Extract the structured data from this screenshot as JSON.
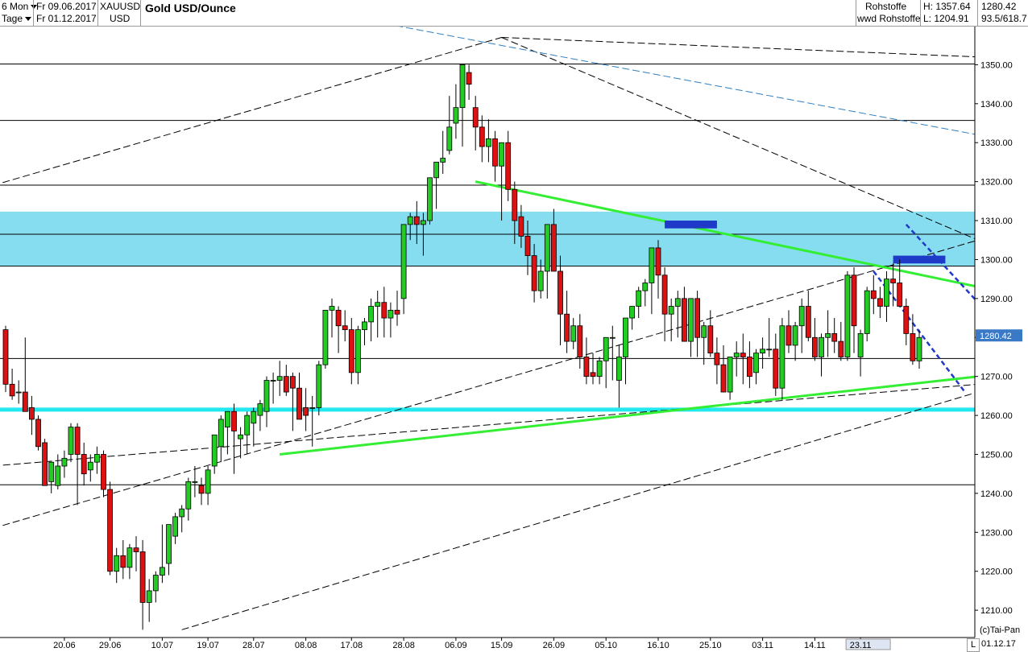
{
  "header": {
    "range_label": "6 Mon",
    "interval_label": "Tage",
    "date_from": "Fr 09.06.2017",
    "date_to": "Fr 01.12.2017",
    "symbol": "XAUUSD",
    "currency": "USD",
    "title": "Gold USD/Ounce",
    "category1": "Rohstoffe",
    "category2": "wwd Rohstoffe",
    "high": "H: 1357.64",
    "low": "L: 1204.91",
    "last": "1280.42",
    "extra": "93.5/618.7"
  },
  "footer": {
    "copyright": "(c)Tai-Pan",
    "end_date": "01.12.17",
    "l_button": "L"
  },
  "colors": {
    "up": "#22cc22",
    "down": "#dd1111",
    "zone": "#87ddf0",
    "support": "#22e8f0",
    "trend_green": "#33ee33",
    "blue_dash": "#1f39c8",
    "channel_blue": "#2f7fc0",
    "price_label": "#3a79c6"
  },
  "chart_data": {
    "type": "candlestick",
    "title": "Gold USD/Ounce",
    "ylim": [
      1203,
      1360
    ],
    "yticks": [
      1210,
      1220,
      1230,
      1240,
      1250,
      1260,
      1270,
      1280,
      1290,
      1300,
      1310,
      1320,
      1330,
      1340,
      1350
    ],
    "xtick_labels": [
      "20.06",
      "29.06",
      "10.07",
      "19.07",
      "28.07",
      "08.08",
      "17.08",
      "28.08",
      "06.09",
      "15.09",
      "26.09",
      "05.10",
      "16.10",
      "25.10",
      "03.11",
      "14.11",
      "23.11"
    ],
    "xtick_index": [
      9,
      16,
      24,
      31,
      38,
      46,
      53,
      61,
      69,
      76,
      84,
      92,
      100,
      108,
      116,
      124,
      131
    ],
    "last_price": 1280.42,
    "horizontal_levels": [
      1350.2,
      1335.7,
      1319.1,
      1306.5,
      1298.3,
      1274.6,
      1242.2
    ],
    "zone": [
      1298.3,
      1312.3
    ],
    "support_level": 1261.5,
    "candles": [
      [
        1282,
        1283,
        1266,
        1268
      ],
      [
        1268,
        1272,
        1264,
        1265
      ],
      [
        1266,
        1269,
        1263,
        1266
      ],
      [
        1266,
        1280,
        1262,
        1261
      ],
      [
        1262,
        1265,
        1255,
        1259
      ],
      [
        1259,
        1260,
        1251,
        1252
      ],
      [
        1253,
        1254,
        1242,
        1242
      ],
      [
        1243,
        1248,
        1240,
        1248
      ],
      [
        1242,
        1250,
        1241,
        1247
      ],
      [
        1247,
        1251,
        1244,
        1249
      ],
      [
        1250,
        1258,
        1248,
        1257
      ],
      [
        1257,
        1258,
        1237,
        1250
      ],
      [
        1250,
        1253,
        1242,
        1245
      ],
      [
        1246,
        1250,
        1243,
        1248
      ],
      [
        1248,
        1252,
        1245,
        1250
      ],
      [
        1250,
        1251,
        1239,
        1241
      ],
      [
        1241,
        1243,
        1219,
        1220
      ],
      [
        1220,
        1226,
        1217,
        1224
      ],
      [
        1224,
        1228,
        1218,
        1221
      ],
      [
        1221,
        1227,
        1218,
        1226
      ],
      [
        1226,
        1229,
        1220,
        1225
      ],
      [
        1225,
        1228,
        1205,
        1212
      ],
      [
        1212,
        1218,
        1207,
        1215
      ],
      [
        1215,
        1220,
        1212,
        1219
      ],
      [
        1219,
        1232,
        1217,
        1221
      ],
      [
        1222,
        1231,
        1219,
        1232
      ],
      [
        1229,
        1235,
        1227,
        1234
      ],
      [
        1234,
        1237,
        1230,
        1236
      ],
      [
        1236,
        1244,
        1233,
        1243
      ],
      [
        1243,
        1247,
        1239,
        1243
      ],
      [
        1242,
        1244,
        1237,
        1240
      ],
      [
        1240,
        1247,
        1237,
        1246
      ],
      [
        1247,
        1255,
        1245,
        1255
      ],
      [
        1252,
        1260,
        1248,
        1259
      ],
      [
        1257,
        1261,
        1250,
        1261
      ],
      [
        1261,
        1263,
        1245,
        1256
      ],
      [
        1254,
        1257,
        1249,
        1255
      ],
      [
        1255,
        1261,
        1250,
        1260
      ],
      [
        1258,
        1262,
        1252,
        1261
      ],
      [
        1260,
        1264,
        1256,
        1263
      ],
      [
        1261,
        1270,
        1257,
        1269
      ],
      [
        1269,
        1271,
        1263,
        1269
      ],
      [
        1269,
        1274,
        1265,
        1270
      ],
      [
        1270,
        1273,
        1265,
        1266
      ],
      [
        1270,
        1271,
        1256,
        1267
      ],
      [
        1267,
        1271,
        1259,
        1259
      ],
      [
        1262,
        1267,
        1256,
        1260
      ],
      [
        1262,
        1265,
        1252,
        1262
      ],
      [
        1262,
        1274,
        1260,
        1273
      ],
      [
        1273,
        1284,
        1272,
        1287
      ],
      [
        1287,
        1290,
        1280,
        1288
      ],
      [
        1287,
        1288,
        1276,
        1283
      ],
      [
        1283,
        1287,
        1279,
        1282
      ],
      [
        1282,
        1285,
        1268,
        1271
      ],
      [
        1271,
        1283,
        1268,
        1282
      ],
      [
        1282,
        1285,
        1278,
        1284
      ],
      [
        1284,
        1290,
        1279,
        1288
      ],
      [
        1288,
        1292,
        1280,
        1289
      ],
      [
        1289,
        1293,
        1280,
        1285
      ],
      [
        1285,
        1289,
        1280,
        1287
      ],
      [
        1287,
        1292,
        1283,
        1286
      ],
      [
        1290,
        1302,
        1286,
        1309
      ],
      [
        1309,
        1312,
        1305,
        1311
      ],
      [
        1311,
        1315,
        1304,
        1309
      ],
      [
        1309,
        1312,
        1301,
        1310
      ],
      [
        1310,
        1318,
        1309,
        1321
      ],
      [
        1321,
        1325,
        1313,
        1325
      ],
      [
        1325,
        1333,
        1322,
        1326
      ],
      [
        1328,
        1342,
        1327,
        1334
      ],
      [
        1335,
        1345,
        1331,
        1339
      ],
      [
        1339,
        1350,
        1329,
        1350
      ],
      [
        1348,
        1350,
        1341,
        1345
      ],
      [
        1339,
        1342,
        1328,
        1334
      ],
      [
        1334,
        1337,
        1325,
        1329
      ],
      [
        1329,
        1336,
        1325,
        1331
      ],
      [
        1331,
        1333,
        1320,
        1324
      ],
      [
        1324,
        1328,
        1310,
        1330
      ],
      [
        1330,
        1333,
        1315,
        1318
      ],
      [
        1318,
        1320,
        1304,
        1310
      ],
      [
        1311,
        1314,
        1303,
        1306
      ],
      [
        1306,
        1310,
        1296,
        1301
      ],
      [
        1301,
        1304,
        1289,
        1292
      ],
      [
        1292,
        1300,
        1290,
        1297
      ],
      [
        1297,
        1305,
        1290,
        1309
      ],
      [
        1309,
        1313,
        1298,
        1297
      ],
      [
        1297,
        1301,
        1278,
        1286
      ],
      [
        1286,
        1292,
        1276,
        1279
      ],
      [
        1279,
        1285,
        1277,
        1283
      ],
      [
        1283,
        1286,
        1272,
        1275
      ],
      [
        1275,
        1280,
        1268,
        1270
      ],
      [
        1271,
        1276,
        1268,
        1270
      ],
      [
        1270,
        1275,
        1268,
        1274
      ],
      [
        1274,
        1278,
        1267,
        1280
      ],
      [
        1280,
        1283,
        1269,
        1280
      ],
      [
        1269,
        1278,
        1262,
        1275
      ],
      [
        1275,
        1284,
        1268,
        1285
      ],
      [
        1285,
        1288,
        1282,
        1288
      ],
      [
        1288,
        1293,
        1285,
        1292
      ],
      [
        1292,
        1295,
        1288,
        1294
      ],
      [
        1294,
        1297,
        1286,
        1303
      ],
      [
        1303,
        1305,
        1290,
        1296
      ],
      [
        1296,
        1298,
        1279,
        1286
      ],
      [
        1286,
        1290,
        1279,
        1288
      ],
      [
        1288,
        1292,
        1280,
        1290
      ],
      [
        1290,
        1293,
        1283,
        1279
      ],
      [
        1279,
        1287,
        1275,
        1290
      ],
      [
        1290,
        1292,
        1275,
        1280
      ],
      [
        1280,
        1284,
        1273,
        1283
      ],
      [
        1283,
        1287,
        1275,
        1276
      ],
      [
        1276,
        1280,
        1268,
        1273
      ],
      [
        1273,
        1278,
        1266,
        1266
      ],
      [
        1266,
        1275,
        1264,
        1275
      ],
      [
        1275,
        1279,
        1270,
        1276
      ],
      [
        1276,
        1281,
        1268,
        1275
      ],
      [
        1275,
        1279,
        1267,
        1270
      ],
      [
        1271,
        1277,
        1268,
        1276
      ],
      [
        1276,
        1280,
        1272,
        1277
      ],
      [
        1277,
        1285,
        1275,
        1277
      ],
      [
        1277,
        1281,
        1265,
        1267
      ],
      [
        1267,
        1285,
        1264,
        1283
      ],
      [
        1283,
        1287,
        1276,
        1278
      ],
      [
        1278,
        1284,
        1274,
        1283
      ],
      [
        1283,
        1290,
        1276,
        1288
      ],
      [
        1288,
        1292,
        1279,
        1280
      ],
      [
        1280,
        1285,
        1274,
        1275
      ],
      [
        1275,
        1281,
        1270,
        1280
      ],
      [
        1280,
        1287,
        1275,
        1281
      ],
      [
        1281,
        1285,
        1276,
        1279
      ],
      [
        1279,
        1284,
        1274,
        1275
      ],
      [
        1275,
        1297,
        1274,
        1296
      ],
      [
        1296,
        1298,
        1276,
        1283
      ],
      [
        1275,
        1282,
        1270,
        1281
      ],
      [
        1281,
        1293,
        1279,
        1292
      ],
      [
        1292,
        1296,
        1286,
        1290
      ],
      [
        1290,
        1293,
        1285,
        1288
      ],
      [
        1288,
        1297,
        1284,
        1295
      ],
      [
        1295,
        1299,
        1288,
        1294
      ],
      [
        1294,
        1300,
        1289,
        1288
      ],
      [
        1288,
        1290,
        1278,
        1281
      ],
      [
        1281,
        1286,
        1273,
        1274
      ],
      [
        1274,
        1282,
        1272,
        1280
      ]
    ],
    "trend_lines": [
      {
        "style": "dash-black",
        "points": [
          [
            -2,
            1319
          ],
          [
            76,
            1357
          ]
        ]
      },
      {
        "style": "dash-black",
        "points": [
          [
            76,
            1357
          ],
          [
            149,
            1305
          ]
        ]
      },
      {
        "style": "dash-black",
        "points": [
          [
            76,
            1357
          ],
          [
            149,
            1352
          ]
        ]
      },
      {
        "style": "dash-black",
        "points": [
          [
            -2,
            1231
          ],
          [
            149,
            1305
          ]
        ]
      },
      {
        "style": "dash-black",
        "points": [
          [
            -2,
            1247
          ],
          [
            149,
            1268
          ]
        ]
      },
      {
        "style": "dash-black",
        "points": [
          [
            27,
            1205
          ],
          [
            149,
            1266
          ]
        ]
      },
      {
        "style": "dash-thin-blue",
        "points": [
          [
            44,
            1365
          ],
          [
            149,
            1332
          ]
        ]
      },
      {
        "style": "solid-green",
        "points": [
          [
            42,
            1250
          ],
          [
            149,
            1270
          ]
        ]
      },
      {
        "style": "solid-green",
        "points": [
          [
            72,
            1320
          ],
          [
            149,
            1293
          ]
        ]
      },
      {
        "style": "dash-heavy-blue",
        "points": [
          [
            138,
            1309
          ],
          [
            149,
            1289
          ]
        ]
      },
      {
        "style": "dash-heavy-blue",
        "points": [
          [
            133,
            1297
          ],
          [
            147,
            1266
          ]
        ]
      }
    ],
    "boxes": [
      {
        "x": [
          101,
          109
        ],
        "y": [
          1308,
          1310
        ]
      },
      {
        "x": [
          136,
          144
        ],
        "y": [
          1299,
          1301
        ]
      }
    ]
  }
}
